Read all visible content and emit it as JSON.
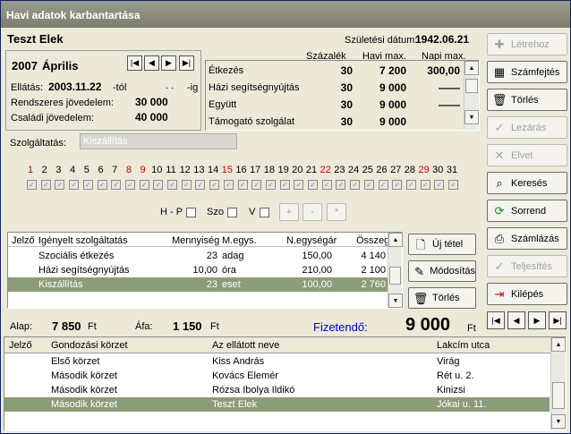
{
  "window": {
    "title": "Havi adatok karbantartása"
  },
  "person": {
    "name": "Teszt Elek",
    "birth_label": "Születési dátum:",
    "birth_date": "1942.06.21"
  },
  "period": {
    "year": "2007",
    "month": "Április",
    "start_label": "Ellátás:",
    "start_date": "2003.11.22",
    "from_suffix": "-tól",
    "end_dots": ". .",
    "to_suffix": "-ig",
    "income_label": "Rendszeres jövedelem:",
    "income": "30 000",
    "family_label": "Családi jövedelem:",
    "family": "40 000"
  },
  "service_table": {
    "headers": [
      "Százalék",
      "Havi max.",
      "Napi max."
    ],
    "rows": [
      {
        "name": "Étkezés",
        "pct": "30",
        "monthly": "7 200",
        "daily": "300,00"
      },
      {
        "name": "Házi segítségnyújtás",
        "pct": "30",
        "monthly": "9 000",
        "daily": "——"
      },
      {
        "name": "Együtt",
        "pct": "30",
        "monthly": "9 000",
        "daily": "——"
      },
      {
        "name": "Támogató szolgálat",
        "pct": "30",
        "monthly": "9 000",
        "daily": ""
      }
    ]
  },
  "service_filter": {
    "label": "Szolgáltatás:",
    "value": "Kiszállítás"
  },
  "days": {
    "numbers": [
      "1",
      "2",
      "3",
      "4",
      "5",
      "6",
      "7",
      "8",
      "9",
      "10",
      "11",
      "12",
      "13",
      "14",
      "15",
      "16",
      "17",
      "18",
      "19",
      "20",
      "21",
      "22",
      "23",
      "24",
      "25",
      "26",
      "27",
      "28",
      "29",
      "30",
      "31"
    ],
    "red": [
      "1",
      "8",
      "9",
      "15",
      "22",
      "29"
    ],
    "hp_label": "H - P",
    "szo_label": "Szo",
    "v_label": "V",
    "plus": "+",
    "minus": "-",
    "star": "*"
  },
  "items": {
    "headers": [
      "Jelző",
      "Igényelt szolgáltatás",
      "Mennyiség",
      "M.egys.",
      "N.egységár",
      "Összeg"
    ],
    "rows": [
      {
        "name": "Szociális étkezés",
        "qty": "23",
        "unit": "adag",
        "price": "150,00",
        "total": "4 140"
      },
      {
        "name": "Házi segítségnyújtás",
        "qty": "10,00",
        "unit": "óra",
        "price": "210,00",
        "total": "2 100"
      },
      {
        "name": "Kiszállítás",
        "qty": "23",
        "unit": "eset",
        "price": "100,00",
        "total": "2 760"
      }
    ]
  },
  "item_buttons": {
    "new": "Új tétel",
    "modify": "Módosítás",
    "delete": "Törlés"
  },
  "totals": {
    "base_label": "Alap:",
    "base": "7 850",
    "base_cur": "Ft",
    "vat_label": "Áfa:",
    "vat": "1 150",
    "vat_cur": "Ft",
    "pay_label": "Fizetendő:",
    "pay": "9 000",
    "pay_cur": "Ft"
  },
  "side_buttons": {
    "create": "Létrehoz",
    "header": "Számfejtés",
    "delete": "Törlés",
    "close": "Lezárás",
    "discard": "Elvet",
    "search": "Keresés",
    "order": "Sorrend",
    "billing": "Számlázás",
    "complete": "Teljesítés",
    "exit": "Kilépés"
  },
  "list": {
    "headers": [
      "Jelző",
      "Gondozási körzet",
      "Az ellátott neve",
      "Lakcím utca"
    ],
    "rows": [
      {
        "district": "Első körzet",
        "name": "Kiss András",
        "street": "Virág"
      },
      {
        "district": "Második körzet",
        "name": "Kovács Elemér",
        "street": "Rét u. 2."
      },
      {
        "district": "Második körzet",
        "name": "Rózsa Ibolya Ildikó",
        "street": "Kinizsi"
      },
      {
        "district": "Második körzet",
        "name": "Teszt Elek",
        "street": "Jókai u. 11."
      }
    ]
  },
  "colors": {
    "accent_blue": "#0000cc",
    "selected_row": "#8c9c78",
    "red_day": "#cc0000"
  }
}
